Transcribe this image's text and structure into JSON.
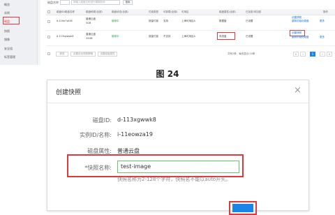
{
  "sidebar": {
    "items": [
      {
        "label": "概览"
      },
      {
        "label": "实例"
      },
      {
        "label": "磁盘"
      },
      {
        "label": "快照"
      },
      {
        "label": "镜像"
      },
      {
        "label": "安全组"
      },
      {
        "label": "标签管理"
      }
    ]
  },
  "search_bar": {
    "label": "磁盘名称",
    "placeholder": "请输入磁盘名称进行模糊查询",
    "search_button": "搜索"
  },
  "table": {
    "headers": [
      "磁盘ID/磁盘名称",
      "磁盘种类(全部)",
      "磁盘状态(全部)",
      "付费类型",
      "可卸载(全部)",
      "可用区",
      "磁盘属性(全部)",
      "已加密/未加密",
      "操作"
    ],
    "rows": [
      {
        "id": "d-11hb7pt18",
        "type": "普通云盘",
        "size": "5GB",
        "status": "使用中",
        "billing": "按量付费",
        "detachable": "支持",
        "zone": "上海可用区A",
        "attribute": "数据盘",
        "encrypt": "已设置",
        "actions": [
          "创建快照",
          "重新初始化磁盘",
          "更多"
        ]
      },
      {
        "id": "d-113xgwwk8",
        "type": "普通云盘",
        "size": "20GB",
        "status": "使用中",
        "billing": "按量付费",
        "detachable": "不支持",
        "zone": "上海可用区A",
        "attribute": "系统盘",
        "encrypt": "已设置",
        "actions": [
          "创建快照",
          "重新初始化磁盘",
          "更多"
        ]
      }
    ],
    "footer_buttons": [
      "释放",
      "设置自动快照策略",
      "设置磁盘属性"
    ],
    "pagination": {
      "summary": "共有2条，每页显示:20条",
      "prev": "«",
      "prev2": "‹",
      "current": "1",
      "next": "›",
      "next2": "»"
    }
  },
  "caption": "图 24",
  "dialog": {
    "title": "创建快照",
    "close_icon": "×",
    "fields": [
      {
        "label": "磁盘ID:",
        "value": "d-113xgwwk8"
      },
      {
        "label": "实例ID/名称:",
        "value": "i-11eowza19"
      },
      {
        "label": "磁盘属性:",
        "value": "普通云盘"
      }
    ],
    "name_label": "*快照名称:",
    "name_value": "test-image",
    "hint": "快照名称为2-128个字符，快照名不能以auto开头。"
  },
  "colors": {
    "highlight": "#e0383b",
    "accent": "#1a85e8",
    "status_green": "#1a9b3c",
    "link": "#0a6fd6"
  }
}
